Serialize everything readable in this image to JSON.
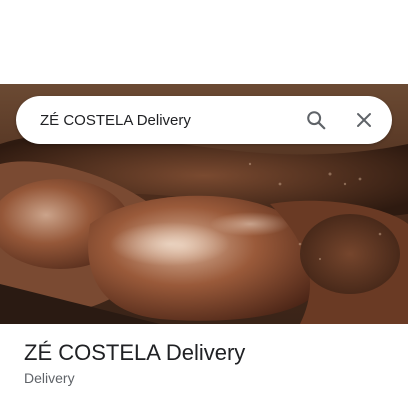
{
  "search": {
    "query": "ZÉ COSTELA Delivery",
    "search_icon": "search-icon",
    "close_icon": "close-icon"
  },
  "photo": {
    "subject": "grilled beef ribs (costela)"
  },
  "place": {
    "title": "ZÉ COSTELA Delivery",
    "category": "Delivery"
  },
  "colors": {
    "title": "#202124",
    "secondary": "#5f6368",
    "icon": "#5f6368"
  }
}
